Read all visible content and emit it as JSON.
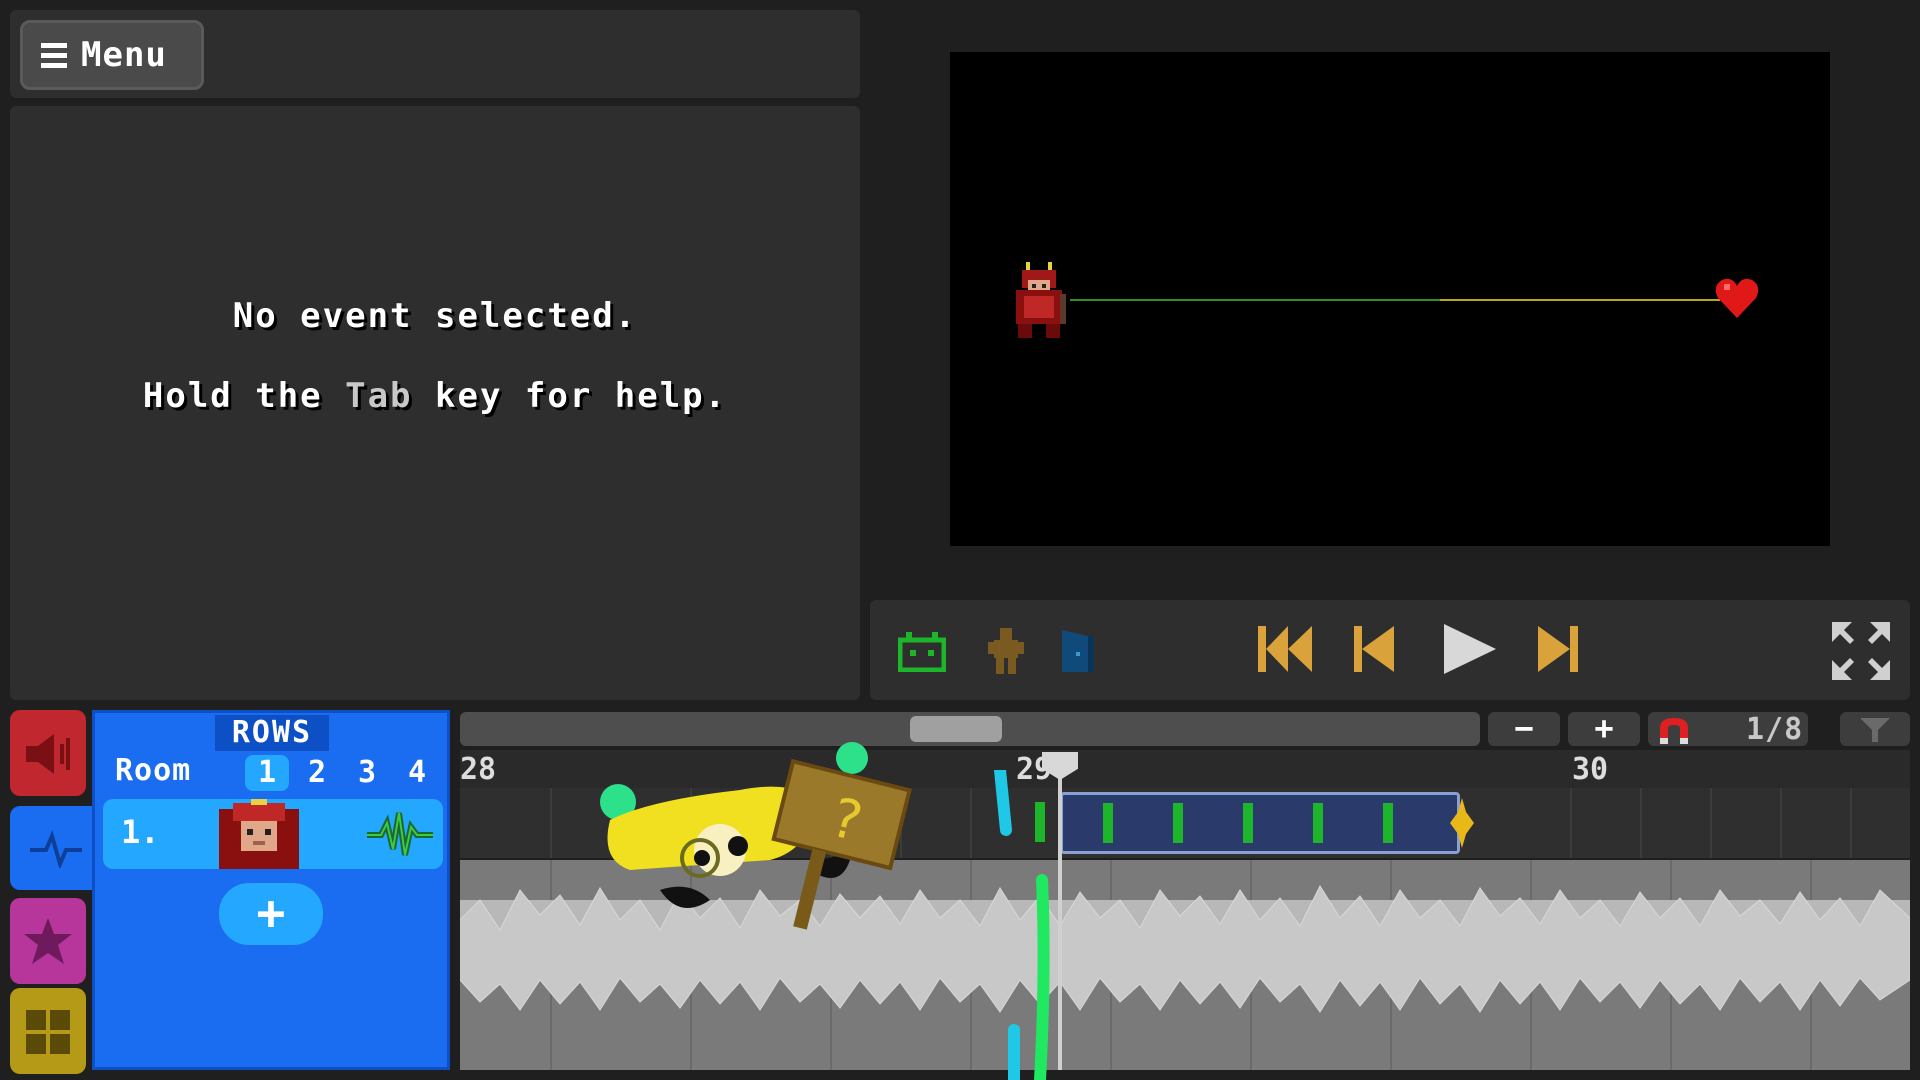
{
  "menu": {
    "label": "Menu"
  },
  "inspector": {
    "message": "No event selected.",
    "help_prefix": "Hold the ",
    "help_key": "Tab",
    "help_suffix": " key for help."
  },
  "tabs": [
    "sound",
    "rows",
    "fx",
    "decorations"
  ],
  "rows_panel": {
    "title": "ROWS",
    "room_label": "Room",
    "rooms": [
      "1",
      "2",
      "3",
      "4"
    ],
    "active_room": "1",
    "row_number": "1.",
    "add_label": "+"
  },
  "timeline": {
    "zoom_out": "−",
    "zoom_in": "+",
    "snap": "1/8",
    "ruler": [
      "28",
      "29",
      "30"
    ]
  },
  "colors": {
    "accent_blue": "#1a6df0",
    "sound_red": "#c0272e",
    "fx_purple": "#b7369c",
    "deco_yellow": "#b49a17",
    "transport_orange": "#d9a23a"
  }
}
